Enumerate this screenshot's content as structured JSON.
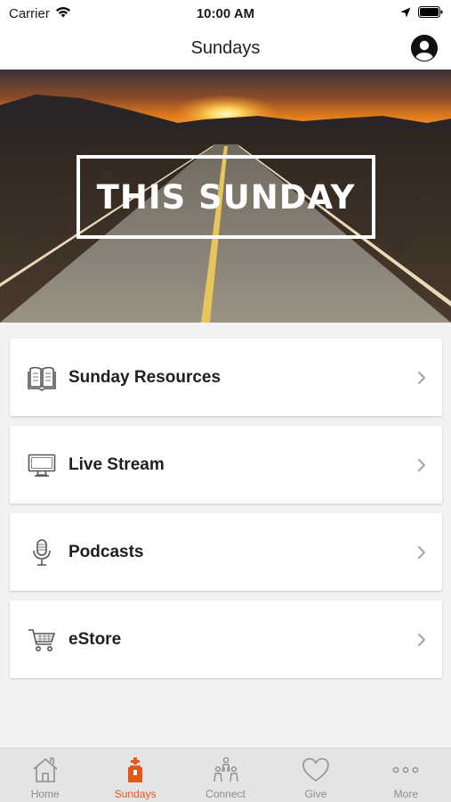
{
  "status_bar": {
    "carrier": "Carrier",
    "time": "10:00 AM"
  },
  "nav": {
    "title": "Sundays"
  },
  "hero": {
    "title": "THIS SUNDAY"
  },
  "menu": {
    "items": [
      {
        "label": "Sunday Resources",
        "icon": "book-icon"
      },
      {
        "label": "Live Stream",
        "icon": "monitor-icon"
      },
      {
        "label": "Podcasts",
        "icon": "microphone-icon"
      },
      {
        "label": "eStore",
        "icon": "cart-icon"
      }
    ]
  },
  "tabs": {
    "items": [
      {
        "label": "Home",
        "icon": "home-icon"
      },
      {
        "label": "Sundays",
        "icon": "sundays-icon",
        "active": true
      },
      {
        "label": "Connect",
        "icon": "people-icon"
      },
      {
        "label": "Give",
        "icon": "heart-icon"
      },
      {
        "label": "More",
        "icon": "more-icon"
      }
    ]
  },
  "colors": {
    "accent": "#e8541c",
    "tab_inactive": "#8e8e8e",
    "background": "#f2f2f2"
  }
}
